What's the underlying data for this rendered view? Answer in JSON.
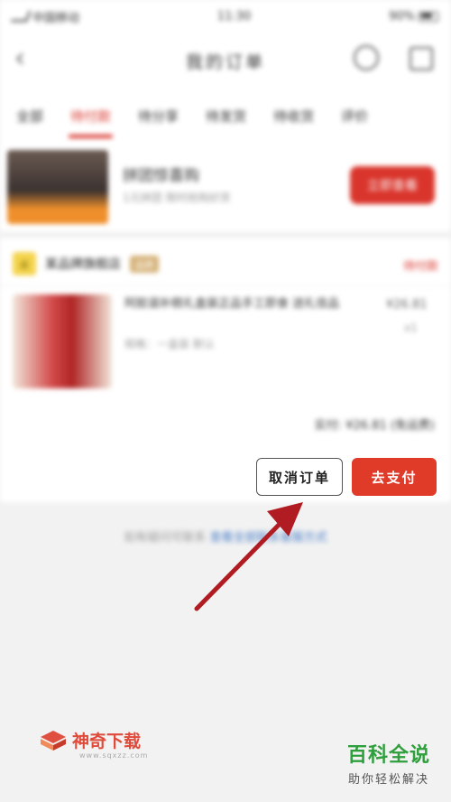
{
  "status_bar": {
    "carrier": "中国移动",
    "time": "11:30",
    "battery": "90%"
  },
  "nav": {
    "back": "‹",
    "title": "我的订单"
  },
  "tabs": [
    {
      "label": "全部"
    },
    {
      "label": "待付款"
    },
    {
      "label": "待分享"
    },
    {
      "label": "待发货"
    },
    {
      "label": "待收货"
    },
    {
      "label": "评价"
    }
  ],
  "promo": {
    "title": "拼团惊喜购",
    "subtitle": "1元拼团 限时抢购好货",
    "button": "立即查看"
  },
  "order": {
    "shop_name": "某品牌旗舰店",
    "shop_tag": "品牌",
    "status": "待付款",
    "product_name": "阿胶滋补糕礼盒装正品手工即食 送礼佳品",
    "product_spec": "规格：一盒装 默认",
    "product_price": "¥26.81",
    "product_qty": "x1",
    "total": "实付: ¥26.81 (免运费)"
  },
  "actions": {
    "cancel": "取消订单",
    "pay": "去支付"
  },
  "footer": {
    "tip": "如有疑问可联系",
    "link": "查看全部联系客服方式"
  },
  "watermark_left": {
    "brand": "神奇下载",
    "url": "www.sqxzz.com"
  },
  "watermark_right": {
    "title": "百科全说",
    "subtitle": "助你轻松解决"
  },
  "colors": {
    "accent": "#d9352c",
    "pay": "#e03a28",
    "arrow": "#b01c22",
    "watermark_green": "#2f9e3c"
  }
}
